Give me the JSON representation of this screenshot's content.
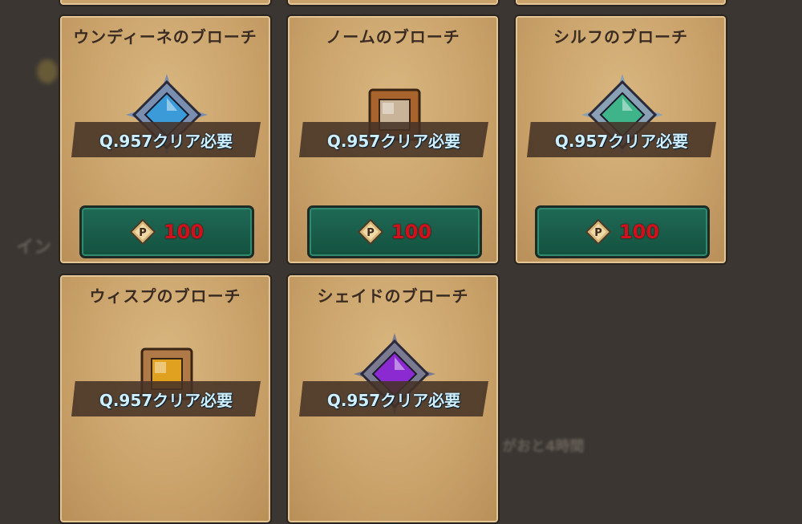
{
  "background": {
    "partial_texts": [
      "イン",
      "がおと4時間"
    ]
  },
  "cards": [
    {
      "title": "ウンディーネのブローチ",
      "requirement": "Q.957クリア必要",
      "price": "100",
      "gem": "#3a9bd8",
      "frame": "#7a8eb0",
      "icon": "undine-brooch-icon"
    },
    {
      "title": "ノームのブローチ",
      "requirement": "Q.957クリア必要",
      "price": "100",
      "gem": "#c9b49a",
      "frame": "#a8642c",
      "icon": "gnome-brooch-icon"
    },
    {
      "title": "シルフのブローチ",
      "requirement": "Q.957クリア必要",
      "price": "100",
      "gem": "#3fb38a",
      "frame": "#8aa0b4",
      "icon": "sylph-brooch-icon"
    },
    {
      "title": "ウィスプのブローチ",
      "requirement": "Q.957クリア必要",
      "price": "",
      "gem": "#e0a020",
      "frame": "#b07a48",
      "icon": "wisp-brooch-icon"
    },
    {
      "title": "シェイドのブローチ",
      "requirement": "Q.957クリア必要",
      "price": "",
      "gem": "#8a2ad0",
      "frame": "#7a7a90",
      "icon": "shade-brooch-icon"
    }
  ],
  "currency_icon": "p-coin-icon",
  "currency_symbol": "P"
}
